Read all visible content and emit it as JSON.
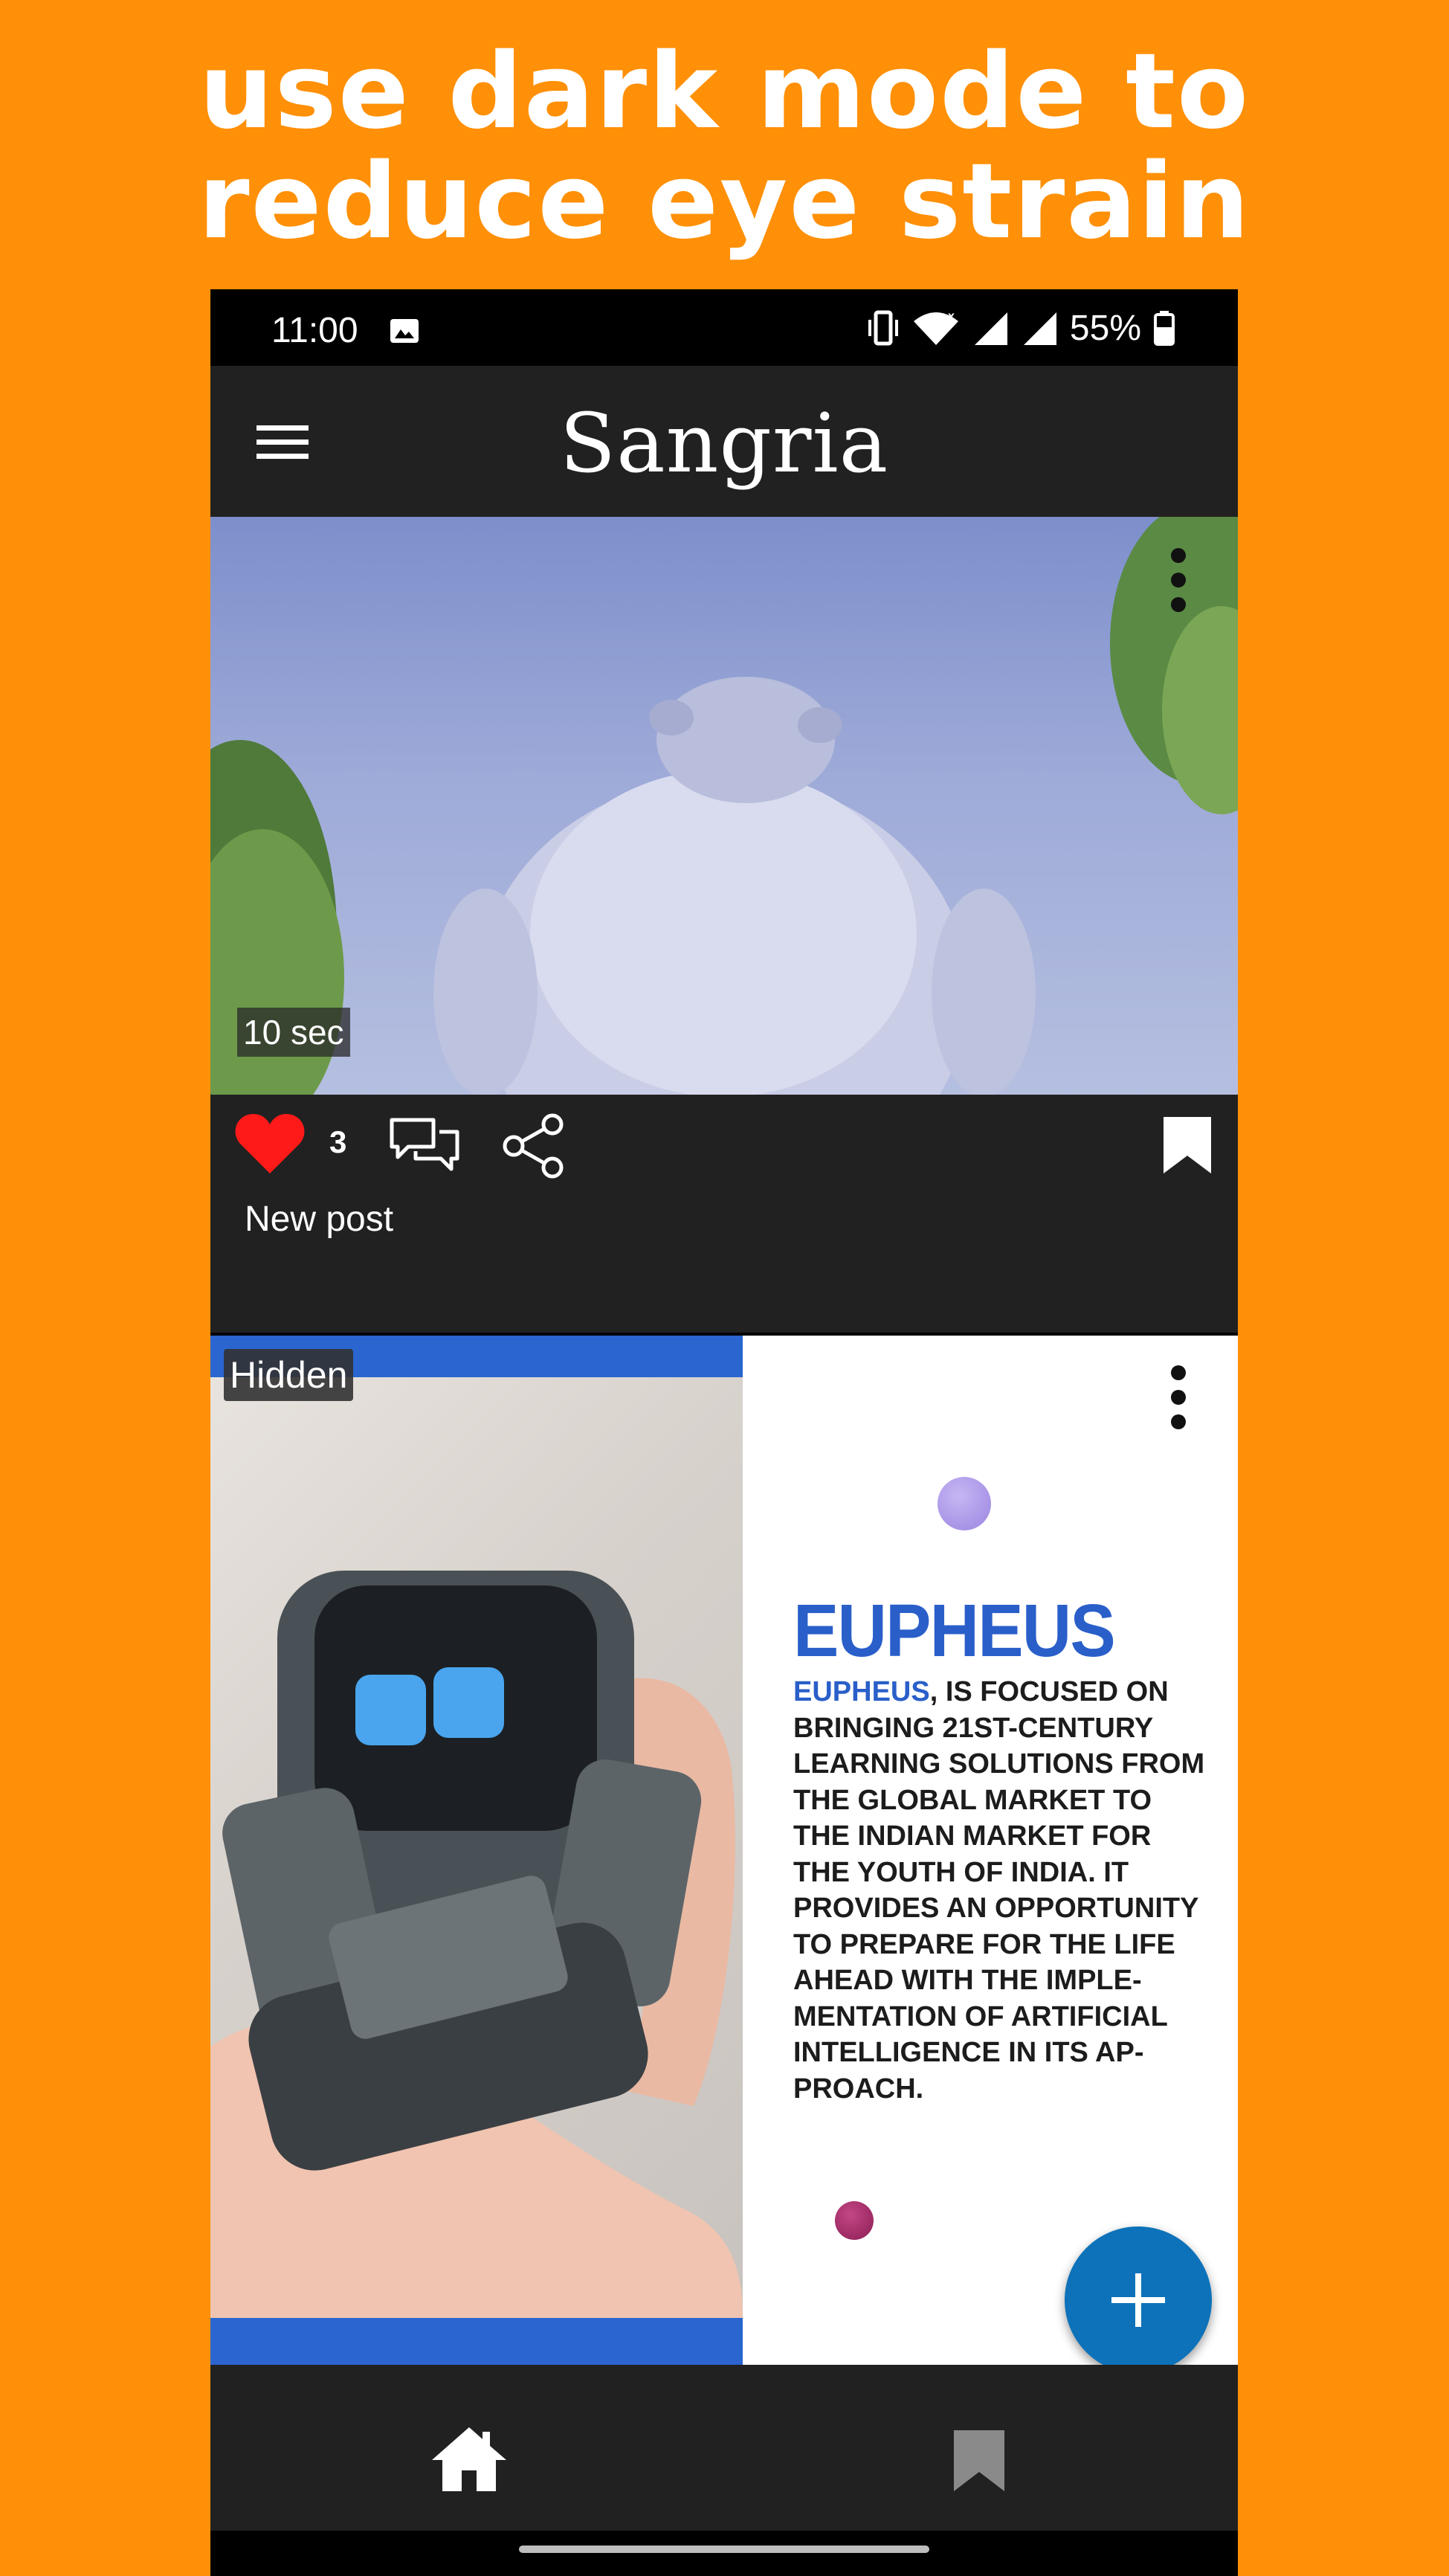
{
  "headline": {
    "line1": "use dark mode to",
    "line2": "reduce eye strain"
  },
  "status_bar": {
    "time": "11:00",
    "battery": "55%",
    "icons": [
      "image-icon",
      "vibrate-icon",
      "wifi-icon",
      "signal-icon",
      "signal-icon",
      "battery-icon"
    ]
  },
  "app_bar": {
    "title": "Sangria",
    "menu_icon": "menu-icon"
  },
  "posts": [
    {
      "duration": "10 sec",
      "likes": "3",
      "caption": "New post",
      "icons": [
        "heart-icon",
        "comment-icon",
        "share-icon",
        "bookmark-icon",
        "more-vert-icon"
      ]
    },
    {
      "badge": "Hidden",
      "image_text": {
        "title": "EUPHEUS",
        "highlight": "EUPHEUS",
        "body": ", IS FOCUSED ON BRINGING 21ST-CENTURY LEARNING SOLUTIONS FROM THE GLOBAL MARKET TO THE INDIAN MARKET FOR THE YOUTH OF INDIA. IT PROVIDES AN OPPORTUNITY TO PREPARE FOR THE LIFE AHEAD WITH THE IMPLE-MENTATION OF ARTIFICIAL INTELLIGENCE IN ITS AP-PROACH."
      }
    }
  ],
  "fab": {
    "icon": "plus-icon"
  },
  "bottom_nav": {
    "items": [
      "home-icon",
      "bookmark-icon"
    ]
  },
  "colors": {
    "background": "#ff9008",
    "app_bar": "#212121",
    "fab": "#0d72b9",
    "like": "#ff1a1a",
    "accent_blue": "#2a5fc9"
  }
}
